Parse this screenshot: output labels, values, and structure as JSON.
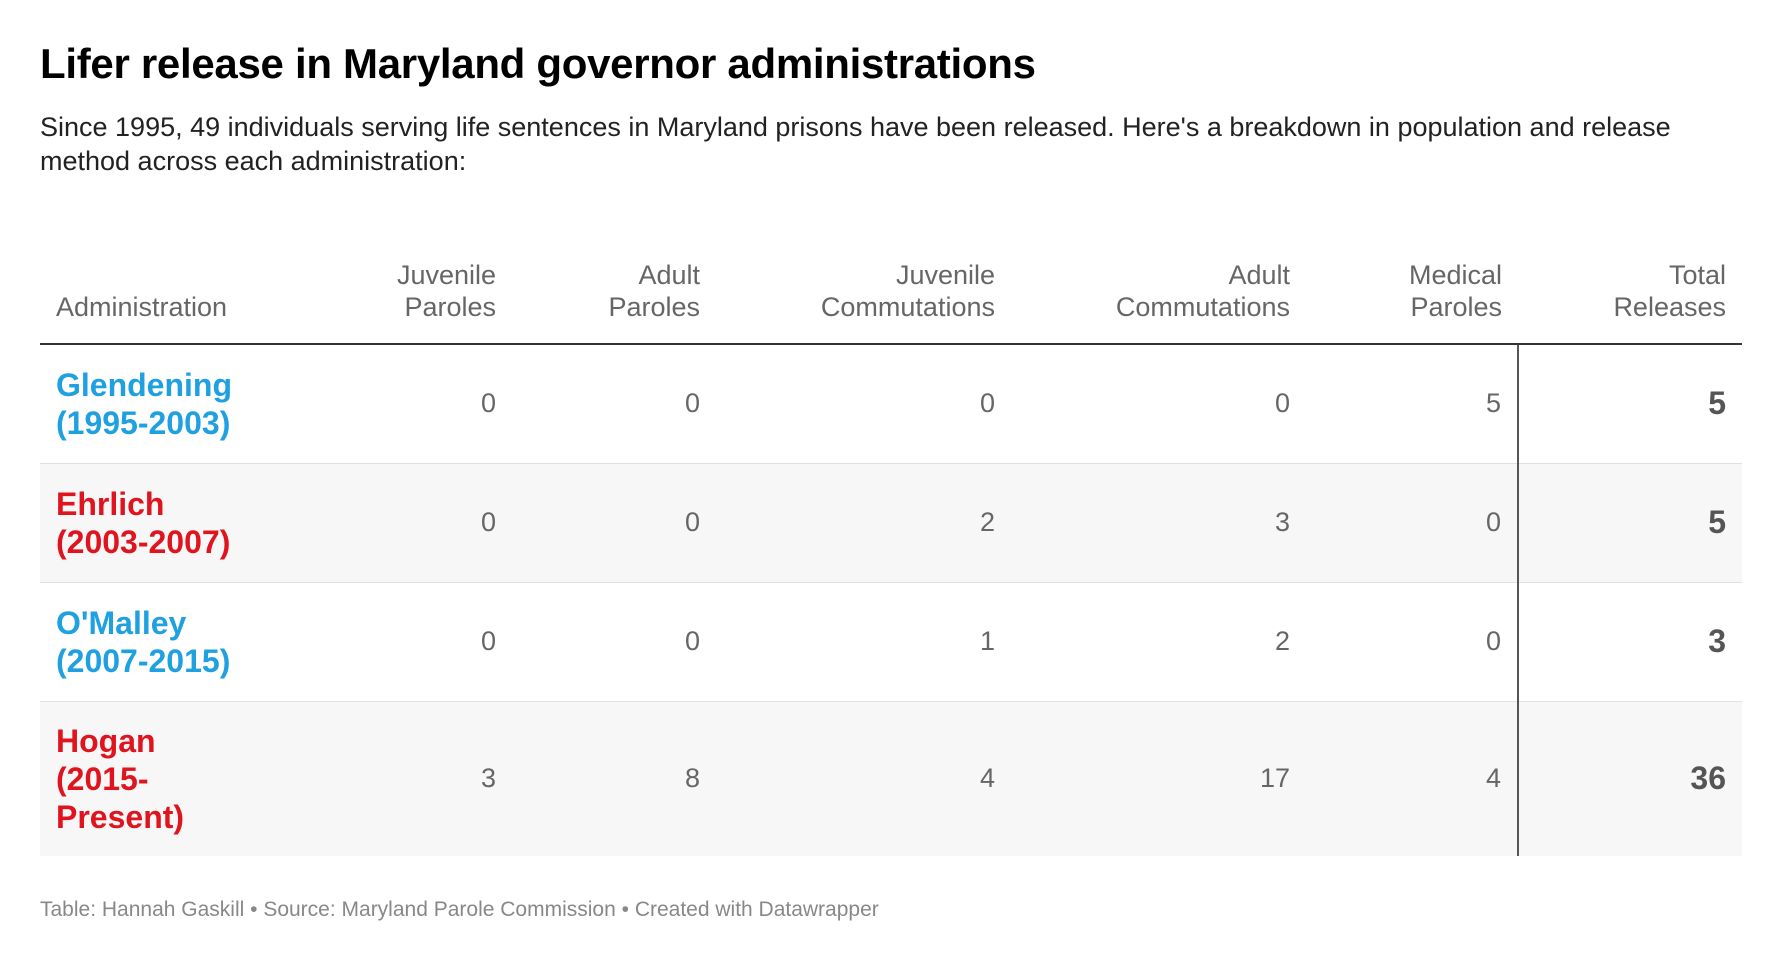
{
  "title": "Lifer release in Maryland governor administrations",
  "subtitle": "Since 1995, 49 individuals serving life sentences in Maryland prisons have been released. Here's a breakdown in population and release method across each administration:",
  "footer": {
    "credit": "Table: Hannah Gaskill",
    "source": "Source: Maryland Parole Commission",
    "tool": "Created with Datawrapper",
    "separator": " • "
  },
  "colors": {
    "democrat": "#1fa0e0",
    "republican": "#e0141e"
  },
  "chart_data": {
    "type": "table",
    "columns": [
      [
        "Administration"
      ],
      [
        "Juvenile",
        "Paroles"
      ],
      [
        "Adult",
        "Paroles"
      ],
      [
        "Juvenile",
        "Commutations"
      ],
      [
        "Adult",
        "Commutations"
      ],
      [
        "Medical",
        "Paroles"
      ],
      [
        "Total",
        "Releases"
      ]
    ],
    "rows": [
      {
        "administration": [
          "Glendening",
          "(1995-2003)"
        ],
        "party": "democrat",
        "values": [
          "0",
          "0",
          "0",
          "0",
          "5",
          "5"
        ]
      },
      {
        "administration": [
          "Ehrlich",
          "(2003-2007)"
        ],
        "party": "republican",
        "values": [
          "0",
          "0",
          "2",
          "3",
          "0",
          "5"
        ]
      },
      {
        "administration": [
          "O'Malley",
          "(2007-2015)"
        ],
        "party": "democrat",
        "values": [
          "0",
          "0",
          "1",
          "2",
          "0",
          "3"
        ]
      },
      {
        "administration": [
          "Hogan",
          "(2015-",
          "Present)"
        ],
        "party": "republican",
        "values": [
          "3",
          "8",
          "4",
          "17",
          "4",
          "36"
        ]
      }
    ]
  }
}
